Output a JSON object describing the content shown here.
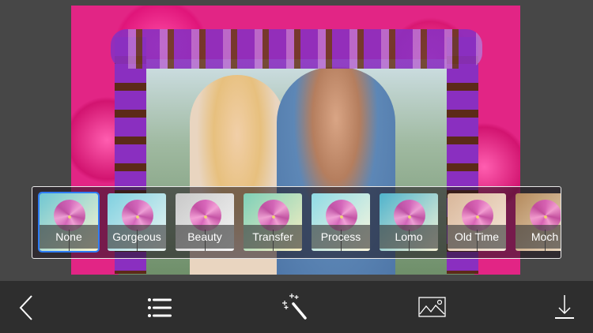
{
  "filters": [
    {
      "label": "None",
      "bg": "linear-gradient(135deg,#6fc7d3,#fdf6cf)",
      "selected": true
    },
    {
      "label": "Gorgeous",
      "bg": "linear-gradient(135deg,#7fd0e0,#eef7f3)",
      "selected": false
    },
    {
      "label": "Beauty",
      "bg": "linear-gradient(135deg,#c9c9c9,#f6f6f6)",
      "selected": false
    },
    {
      "label": "Transfer",
      "bg": "linear-gradient(135deg,#7ed0b8,#fbefc2)",
      "selected": false
    },
    {
      "label": "Process",
      "bg": "linear-gradient(135deg,#8fdbe6,#fdf7dd)",
      "selected": false
    },
    {
      "label": "Lomo",
      "bg": "linear-gradient(135deg,#4fb3cc,#f7f4d7)",
      "selected": false
    },
    {
      "label": "Old Time",
      "bg": "linear-gradient(135deg,#d9b79a,#f6e9dc)",
      "selected": false
    },
    {
      "label": "Moch",
      "bg": "linear-gradient(135deg,#b48a5c,#f2e2cc)",
      "selected": false
    }
  ],
  "toolbar": {
    "icons": [
      "back-icon",
      "list-icon",
      "magic-wand-icon",
      "image-icon",
      "download-icon"
    ]
  },
  "colors": {
    "selected": "#2d7cf6",
    "toolbar": "#2e2e2e",
    "background": "#474747"
  }
}
